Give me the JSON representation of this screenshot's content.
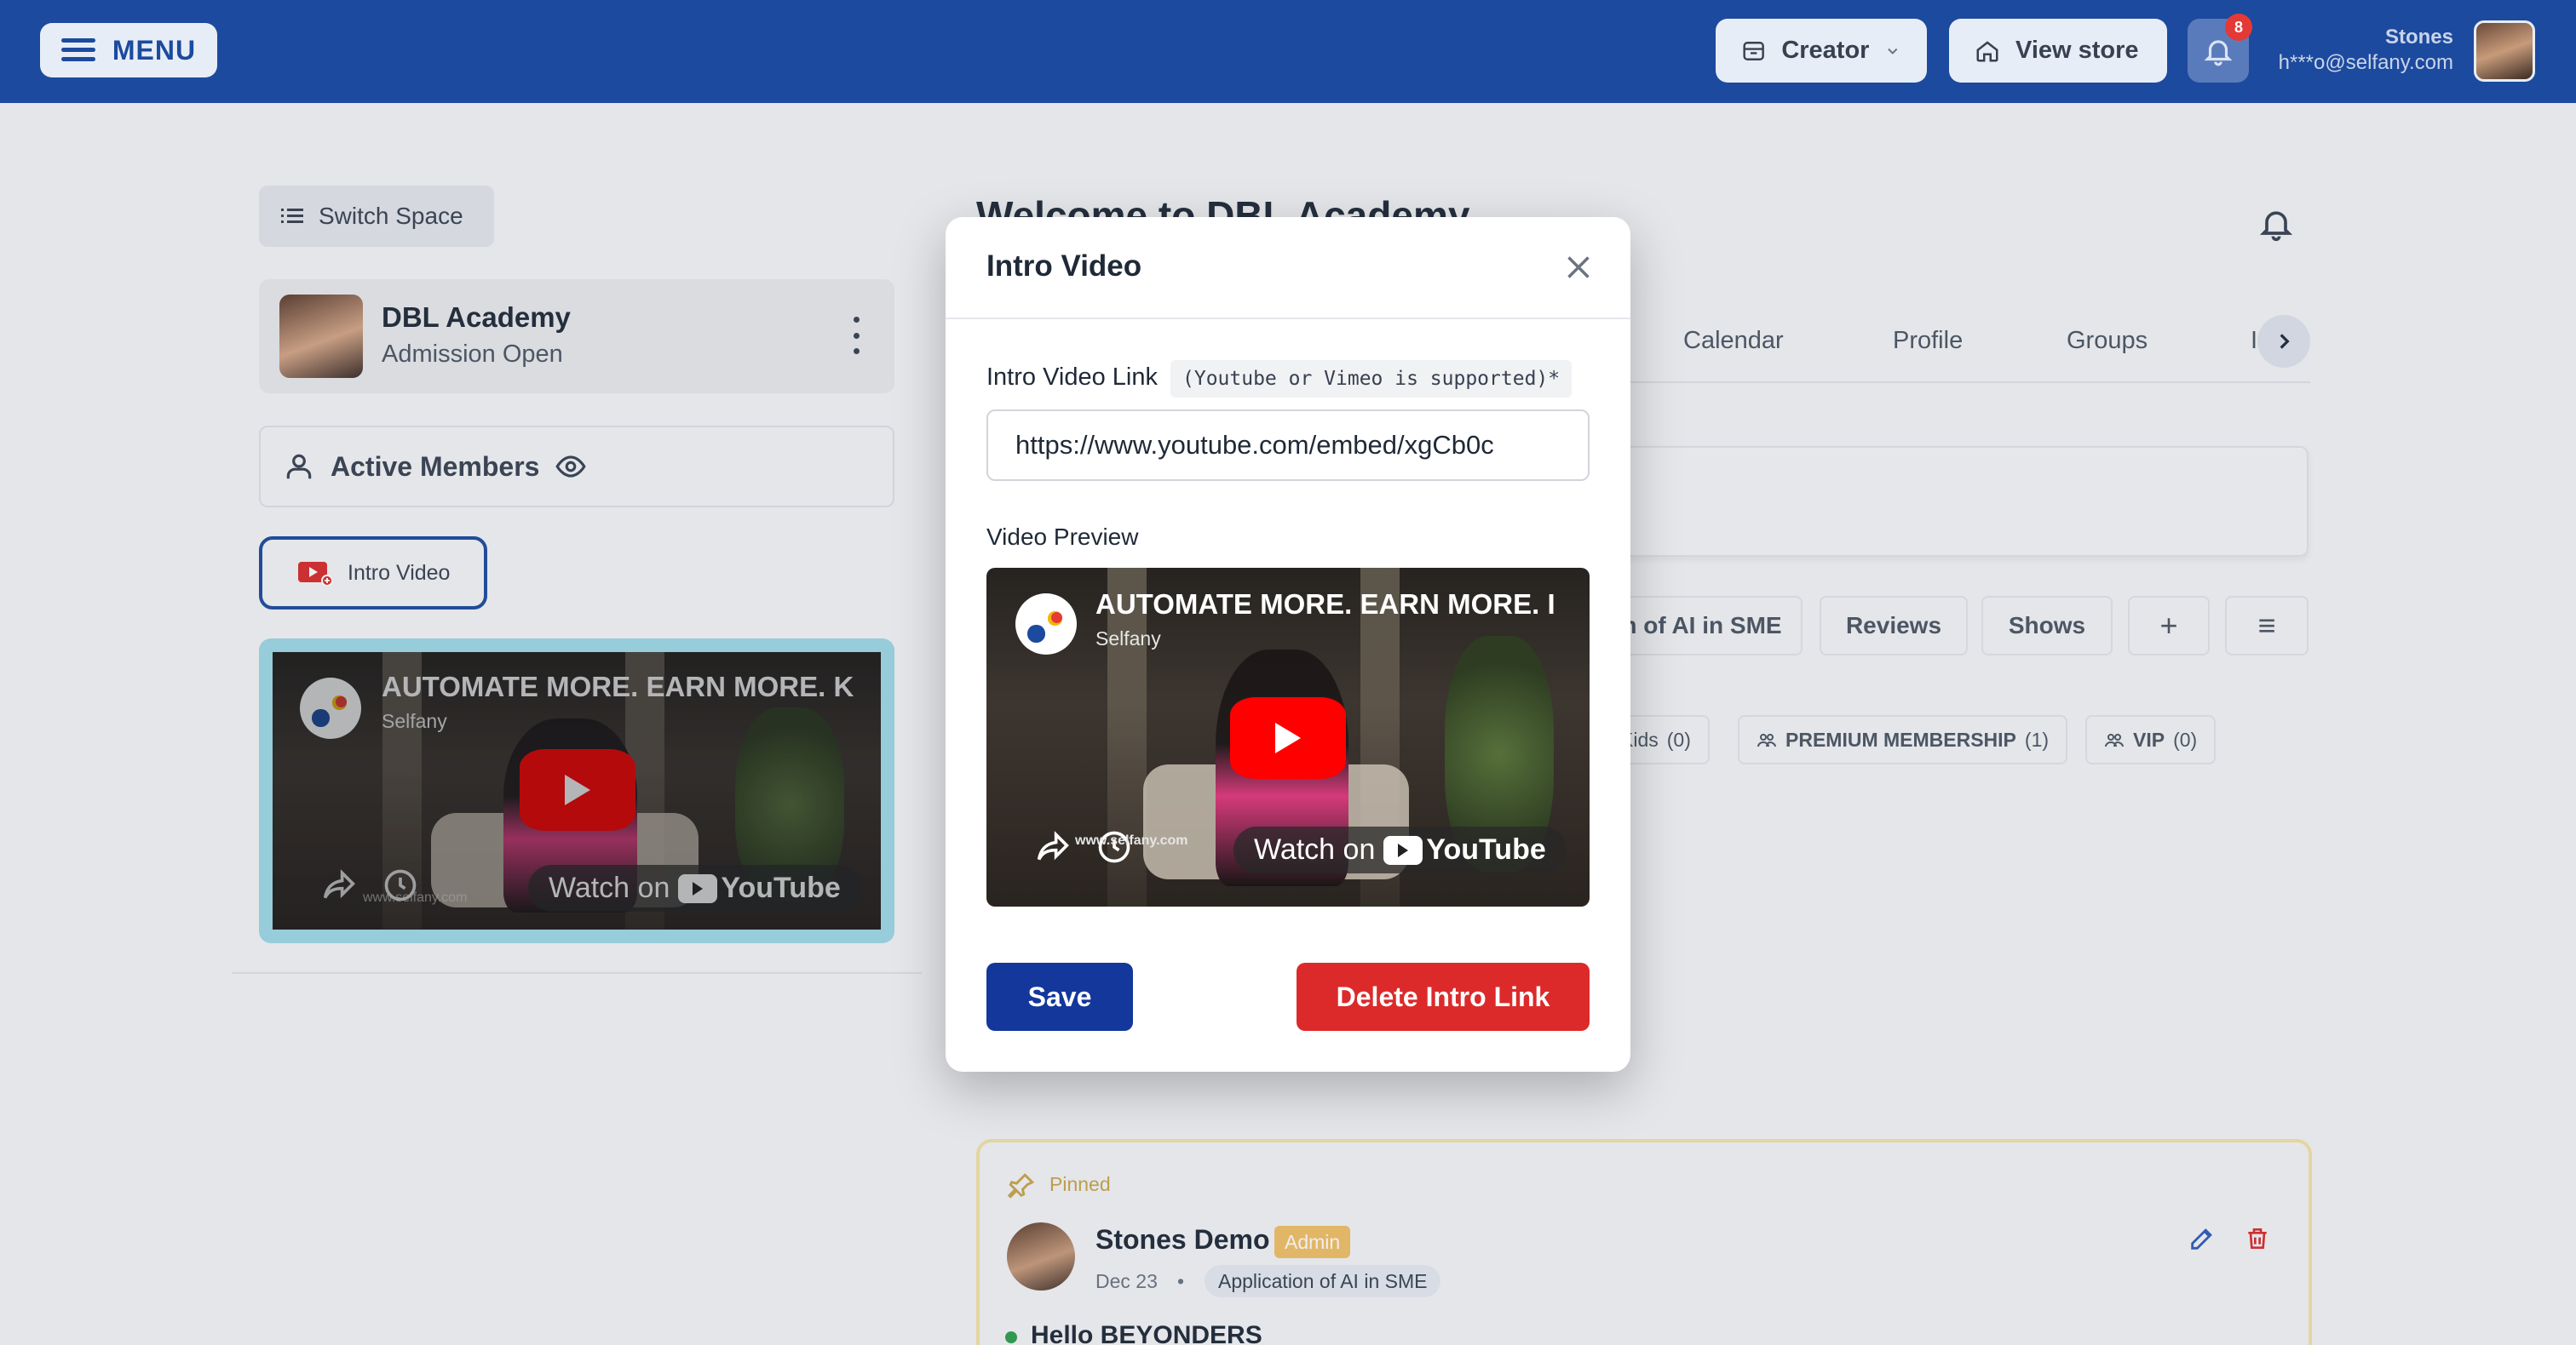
{
  "topbar": {
    "menu_label": "MENU",
    "creator_label": "Creator",
    "view_store_label": "View store",
    "notification_count": "8",
    "user_name": "Stones",
    "user_email": "h***o@selfany.com"
  },
  "sidebar": {
    "switch_space_label": "Switch Space",
    "space_title": "DBL Academy",
    "space_subtitle": "Admission Open",
    "active_members_label": "Active Members",
    "intro_video_label": "Intro Video"
  },
  "video": {
    "title": "AUTOMATE MORE. EARN MORE. K",
    "preview_title": "AUTOMATE MORE. EARN MORE. I",
    "channel": "Selfany",
    "watch_on": "Watch on",
    "youtube": "YouTube",
    "watermark": "www.selfany.com"
  },
  "main": {
    "welcome_title": "Welcome to DBL Academy",
    "tabs": [
      {
        "label": "Calendar"
      },
      {
        "label": "Profile"
      },
      {
        "label": "Groups"
      },
      {
        "label": "I"
      }
    ],
    "chips": [
      {
        "label": "n of AI in SME"
      },
      {
        "label": "Reviews"
      },
      {
        "label": "Shows"
      },
      {
        "label": "+"
      },
      {
        "label": "≡"
      }
    ],
    "pills": [
      {
        "label": "Kids",
        "count": "(0)"
      },
      {
        "label": "PREMIUM MEMBERSHIP",
        "count": "(1)"
      },
      {
        "label": "VIP",
        "count": "(0)"
      }
    ],
    "pinned_post": {
      "pinned_label": "Pinned",
      "author": "Stones Demo",
      "badge": "Admin",
      "date": "Dec 23",
      "separator": "•",
      "group": "Application of AI in SME",
      "title": "Hello BEYONDERS"
    }
  },
  "modal": {
    "title": "Intro Video",
    "field_label": "Intro Video Link",
    "field_hint": "(Youtube or Vimeo is supported)*",
    "url_value": "https://www.youtube.com/embed/xgCb0c",
    "preview_label": "Video Preview",
    "save_label": "Save",
    "delete_label": "Delete Intro Link"
  },
  "colors": {
    "brand": "#1c4a9e",
    "save": "#13379b",
    "delete": "#dc2a2a",
    "youtube_red": "#ff0000"
  }
}
